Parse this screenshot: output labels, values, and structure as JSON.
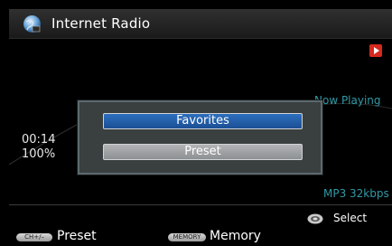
{
  "header": {
    "title": "Internet Radio",
    "icon": "globe-icon"
  },
  "player": {
    "now_playing": "Now Playing",
    "elapsed_time": "00:14",
    "buffer_level": "100%",
    "format_info": "MP3 32kbps",
    "indicator_icon": "play-indicator-icon",
    "indicator_color": "#d7281e"
  },
  "popup": {
    "options": [
      {
        "label": "Favorites",
        "selected": true
      },
      {
        "label": "Preset",
        "selected": false
      }
    ],
    "selected_color": "#2d6fbf"
  },
  "footer": {
    "select_label": "Select",
    "select_icon": "ok-icon",
    "ch_chip": "CH+/–",
    "preset_label": "Preset",
    "memory_chip": "MEMORY",
    "memory_label": "Memory"
  },
  "colors": {
    "accent_text": "#2f9aa6",
    "background": "#000000"
  }
}
